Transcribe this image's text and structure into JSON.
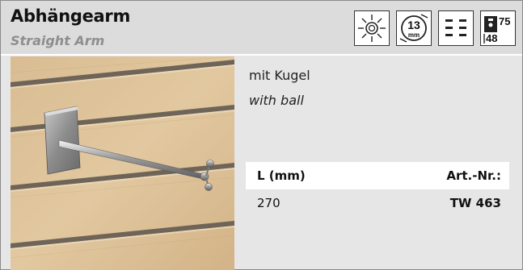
{
  "product": {
    "title": "Abhängearm",
    "subtitle": "Straight Arm"
  },
  "icons": [
    {
      "name": "sun-icon"
    },
    {
      "name": "slot-size-icon",
      "value": "13",
      "unit": "mm"
    },
    {
      "name": "slot-pattern-icon"
    },
    {
      "name": "spacing-icon",
      "top": "75",
      "bottom": "48"
    }
  ],
  "description": {
    "de": "mit Kugel",
    "en": "with ball"
  },
  "table": {
    "headers": [
      "L (mm)",
      "Art.-Nr.:"
    ],
    "rows": [
      [
        "270",
        "TW 463"
      ]
    ]
  },
  "colors": {
    "header_bg": "#dcdcdc",
    "panel_bg": "#e6e6e6",
    "subtitle": "#8e8e8e"
  }
}
